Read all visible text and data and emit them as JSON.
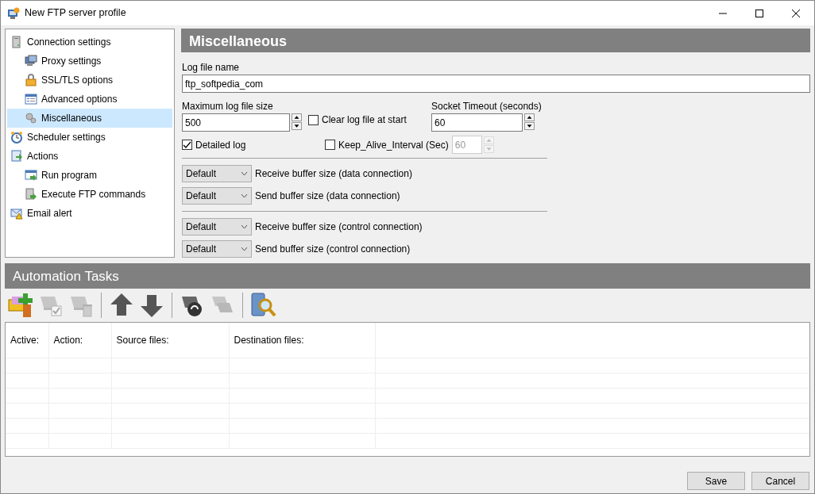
{
  "window": {
    "title": "New FTP server profile"
  },
  "tree": [
    {
      "label": "Connection settings",
      "selected": false,
      "children": [
        {
          "label": "Proxy settings",
          "selected": false
        },
        {
          "label": "SSL/TLS options",
          "selected": false
        },
        {
          "label": "Advanced options",
          "selected": false
        },
        {
          "label": "Miscellaneous",
          "selected": true
        }
      ]
    },
    {
      "label": "Scheduler settings",
      "selected": false
    },
    {
      "label": "Actions",
      "selected": false,
      "children": [
        {
          "label": "Run program",
          "selected": false
        },
        {
          "label": "Execute FTP commands",
          "selected": false
        }
      ]
    },
    {
      "label": "Email alert",
      "selected": false
    }
  ],
  "section": {
    "title": "Miscellaneous"
  },
  "log_file": {
    "label": "Log file name",
    "value": "ftp_softpedia_com"
  },
  "max_log_size": {
    "label": "Maximum log file size",
    "value": "500"
  },
  "clear_log": {
    "label": "Clear log file at start",
    "checked": false
  },
  "socket_timeout": {
    "label": "Socket Timeout (seconds)",
    "value": "60"
  },
  "detailed_log": {
    "label": "Detailed log",
    "checked": true
  },
  "keep_alive": {
    "label": "Keep_Alive_Interval (Sec)",
    "checked": false,
    "value": "60",
    "disabled": true
  },
  "buffer_groups": [
    [
      {
        "value": "Default",
        "label": "Receive buffer size (data connection)"
      },
      {
        "value": "Default",
        "label": "Send buffer size (data connection)"
      }
    ],
    [
      {
        "value": "Default",
        "label": "Receive buffer size (control connection)"
      },
      {
        "value": "Default",
        "label": "Send buffer size (control connection)"
      }
    ]
  ],
  "automation": {
    "title": "Automation Tasks",
    "toolbar": [
      [
        {
          "kind": "add",
          "disabled": false
        },
        {
          "kind": "edit",
          "disabled": true
        },
        {
          "kind": "delete",
          "disabled": true
        }
      ],
      [
        {
          "kind": "up",
          "disabled": false
        },
        {
          "kind": "down",
          "disabled": false
        }
      ],
      [
        {
          "kind": "run",
          "disabled": false
        },
        {
          "kind": "copy",
          "disabled": true
        }
      ],
      [
        {
          "kind": "search",
          "disabled": false
        }
      ]
    ],
    "columns": [
      "Active:",
      "Action:",
      "Source files:",
      "Destination files:"
    ]
  },
  "buttons": [
    "Save",
    "Cancel"
  ]
}
